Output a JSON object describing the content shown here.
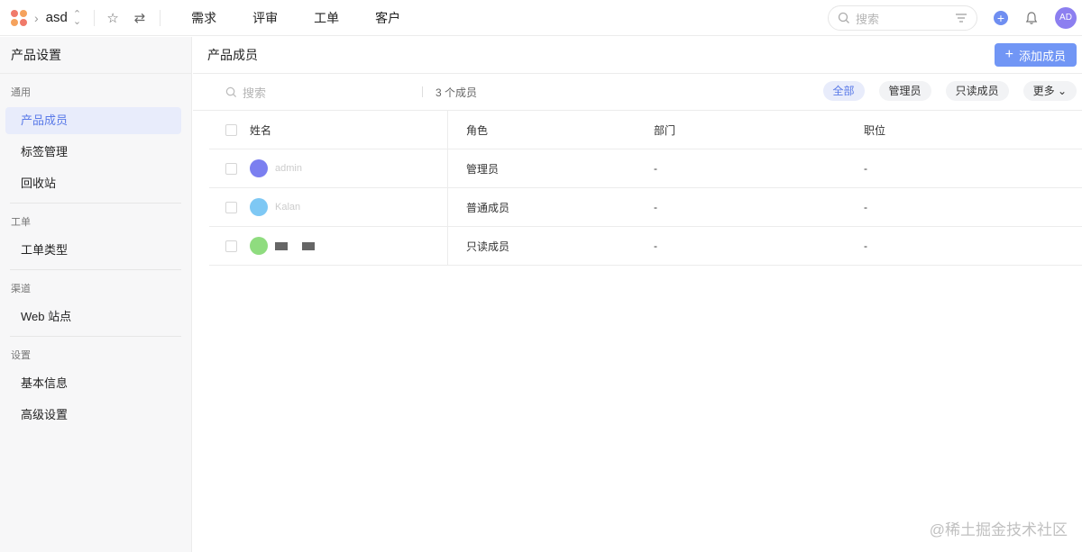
{
  "topbar": {
    "project": "asd",
    "nav": [
      "需求",
      "评审",
      "工单",
      "客户"
    ],
    "search_placeholder": "搜索",
    "avatar_initials": "AD"
  },
  "sidebar": {
    "title": "产品设置",
    "groups": [
      {
        "label": "通用",
        "items": [
          "产品成员",
          "标签管理",
          "回收站"
        ]
      },
      {
        "label": "工单",
        "items": [
          "工单类型"
        ]
      },
      {
        "label": "渠道",
        "items": [
          "Web 站点"
        ]
      },
      {
        "label": "设置",
        "items": [
          "基本信息",
          "高级设置"
        ]
      }
    ]
  },
  "main": {
    "title": "产品成员",
    "add_button": "添加成员",
    "search_placeholder": "搜索",
    "count_text": "3 个成员",
    "filters": [
      "全部",
      "管理员",
      "只读成员",
      "更多"
    ],
    "columns": [
      "姓名",
      "角色",
      "部门",
      "职位"
    ],
    "rows": [
      {
        "name": "admin",
        "role": "管理员",
        "dept": "-",
        "position": "-",
        "avatar_color": "#7b7ff0"
      },
      {
        "name": "Kalan",
        "role": "普通成员",
        "dept": "-",
        "position": "-",
        "avatar_color": "#7ec8f4"
      },
      {
        "name": "",
        "role": "只读成员",
        "dept": "-",
        "position": "-",
        "avatar_color": "#8fdc7f"
      }
    ]
  },
  "watermark": "@稀土掘金技术社区",
  "colors": {
    "accent": "#7196f5",
    "active_text": "#5a7ae8",
    "active_bg": "#e8ecfb"
  }
}
